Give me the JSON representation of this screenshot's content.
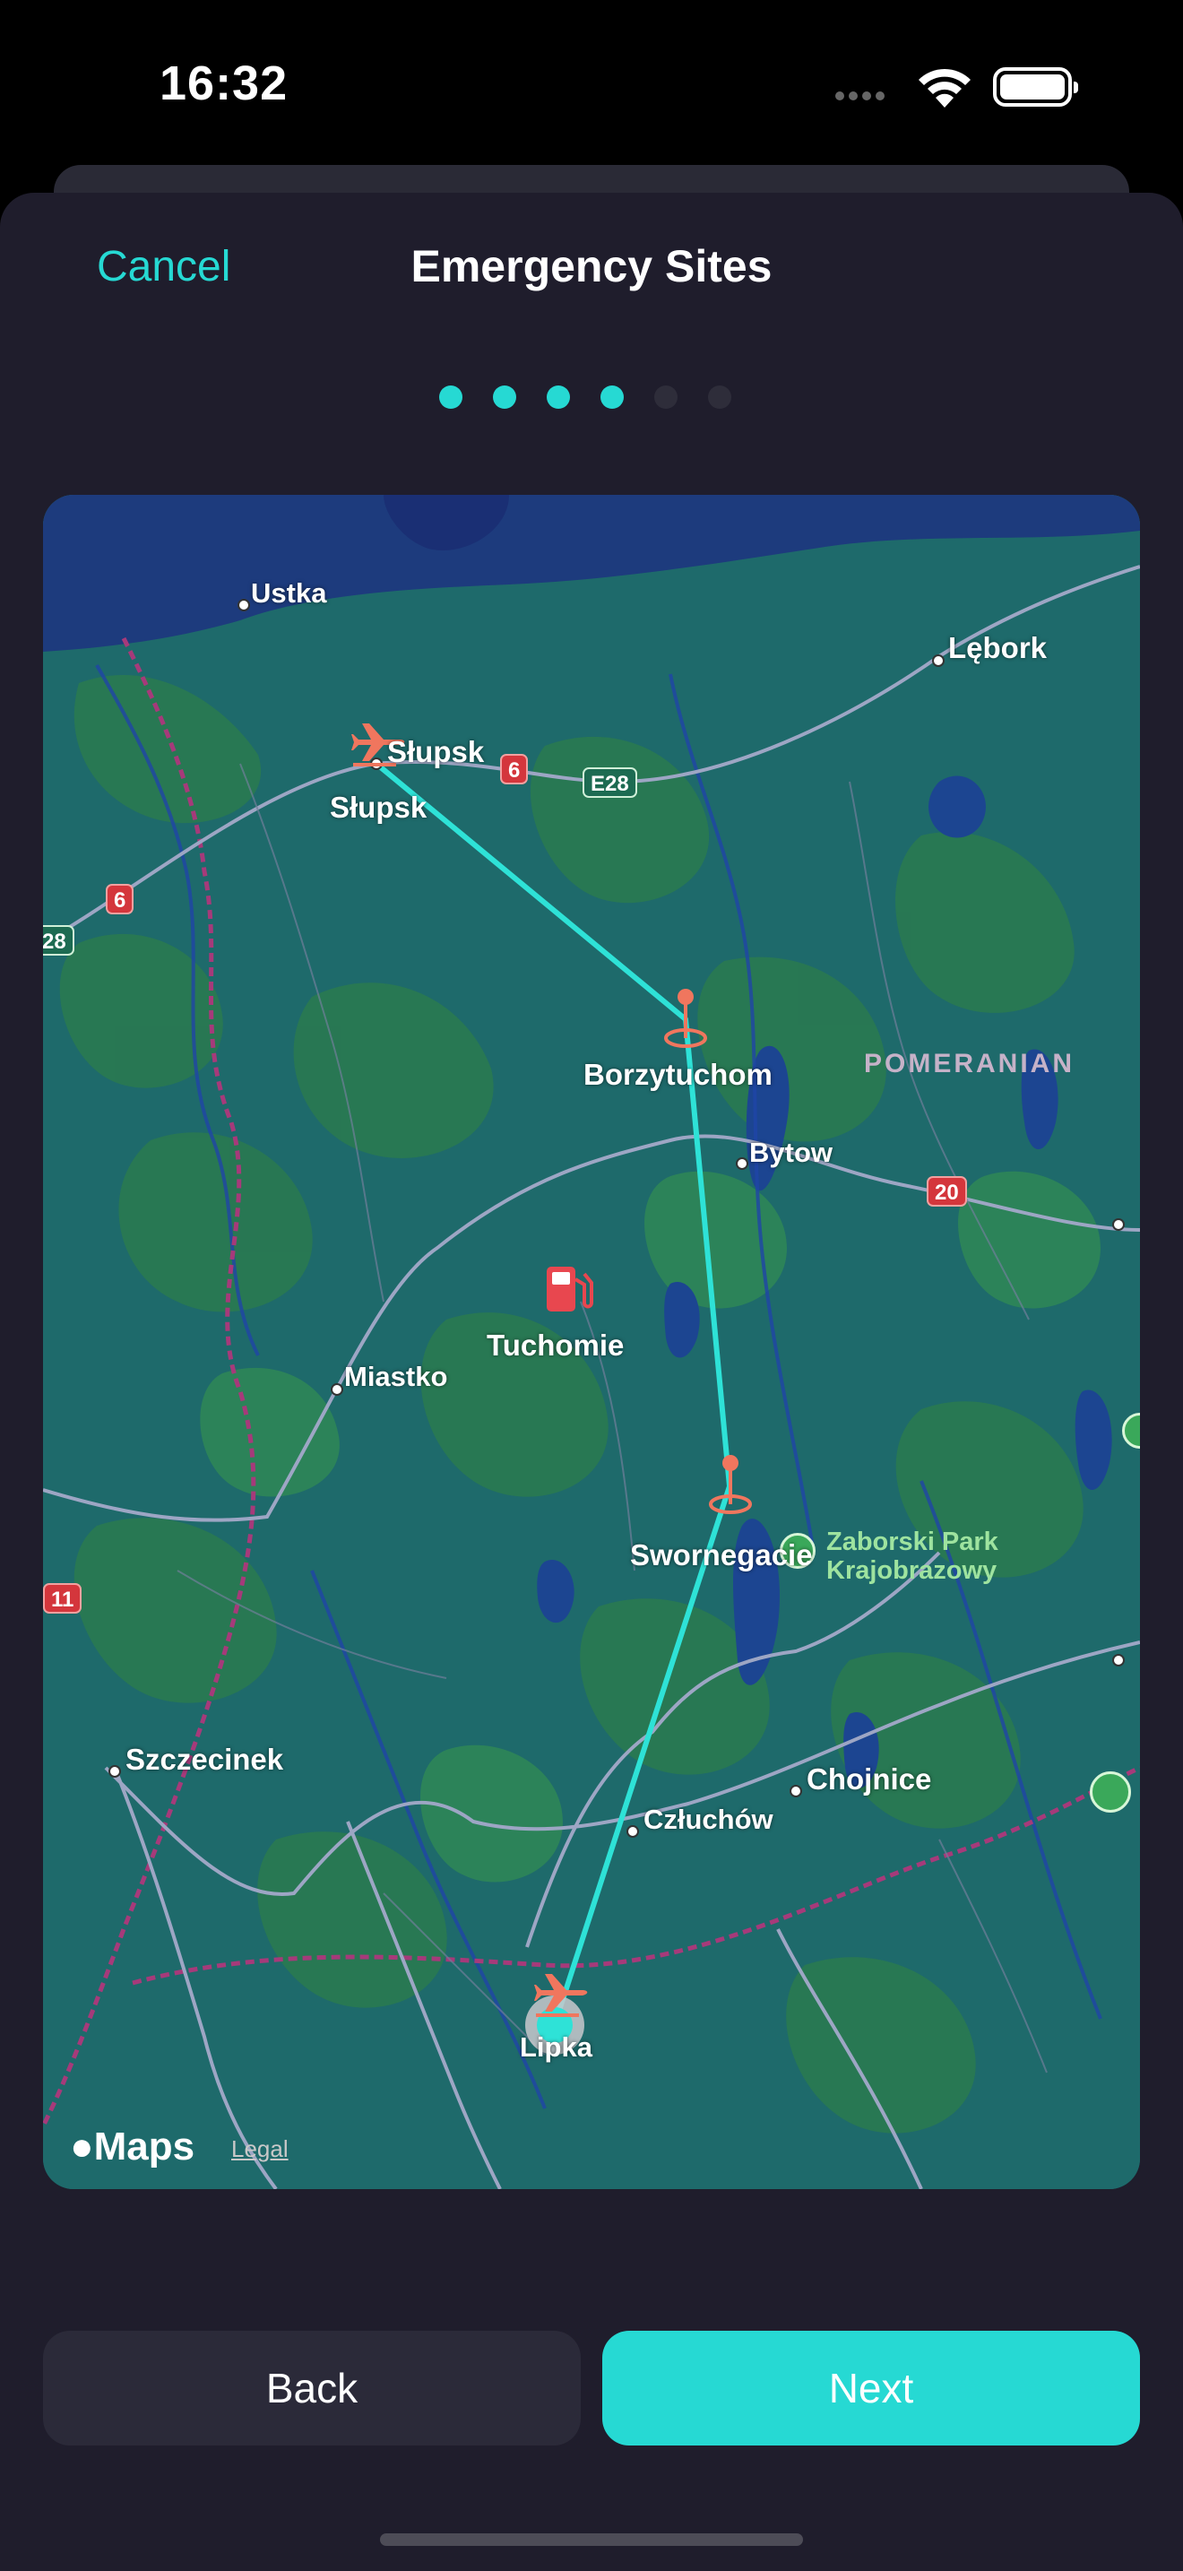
{
  "status_bar": {
    "time": "16:32"
  },
  "header": {
    "cancel_label": "Cancel",
    "title": "Emergency Sites"
  },
  "pager": {
    "total": 6,
    "current": 4,
    "active_color": "#26d9d3",
    "inactive_color": "#2e2d3a"
  },
  "map": {
    "places": {
      "ustka": "Ustka",
      "lebork": "Lębork",
      "slupsk_airport": "Słupsk",
      "slupsk": "Słupsk",
      "borzytuchom": "Borzytuchom",
      "pomeranian": "POMERANIAN",
      "bytow": "Bytow",
      "tuchomie": "Tuchomie",
      "miastko": "Miastko",
      "swornegacie": "Swornegacie",
      "park_line1": "Zaborski Park",
      "park_line2": "Krajobrazowy",
      "szczecinek": "Szczecinek",
      "chojnice": "Chojnice",
      "czluchow": "Człuchów",
      "lipka": "Lipka"
    },
    "road_shields": {
      "r6a": "6",
      "e28a": "E28",
      "r6b": "6",
      "e28b": "28",
      "r20": "20",
      "r11": "11"
    },
    "route_color": "#2ee2d7",
    "marker_color": "#f0765e",
    "logo_text": "Maps",
    "legal_label": "Legal"
  },
  "footer": {
    "back_label": "Back",
    "next_label": "Next"
  }
}
